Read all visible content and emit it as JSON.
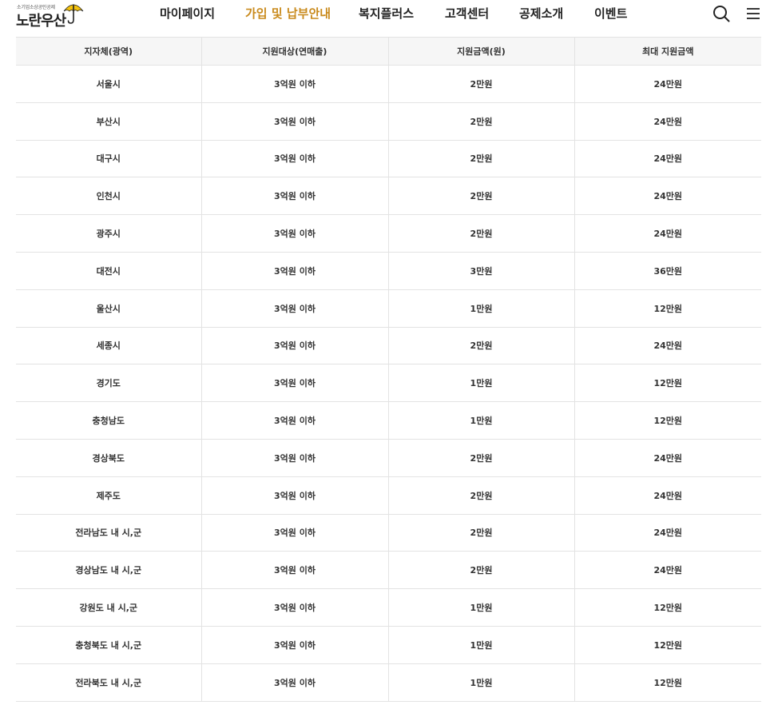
{
  "header": {
    "logo_sub": "소기업소상공인공제",
    "logo_main": "노란우산",
    "nav": [
      {
        "label": "마이페이지",
        "active": false
      },
      {
        "label": "가입 및 납부안내",
        "active": true
      },
      {
        "label": "복지플러스",
        "active": false
      },
      {
        "label": "고객센터",
        "active": false
      },
      {
        "label": "공제소개",
        "active": false
      },
      {
        "label": "이벤트",
        "active": false
      }
    ],
    "icons": [
      "search-icon",
      "menu-icon"
    ]
  },
  "colors": {
    "accent": "#c98a1c",
    "umbrella": "#f4c20d",
    "header_bg": "#f6f6f6",
    "border": "#e3e3e3"
  },
  "table": {
    "headers": [
      "지자체(광역)",
      "지원대상(연매출)",
      "지원금액(원)",
      "최대 지원금액"
    ],
    "rows": [
      [
        "서울시",
        "3억원 이하",
        "2만원",
        "24만원"
      ],
      [
        "부산시",
        "3억원 이하",
        "2만원",
        "24만원"
      ],
      [
        "대구시",
        "3억원 이하",
        "2만원",
        "24만원"
      ],
      [
        "인천시",
        "3억원 이하",
        "2만원",
        "24만원"
      ],
      [
        "광주시",
        "3억원 이하",
        "2만원",
        "24만원"
      ],
      [
        "대전시",
        "3억원 이하",
        "3만원",
        "36만원"
      ],
      [
        "울산시",
        "3억원 이하",
        "1만원",
        "12만원"
      ],
      [
        "세종시",
        "3억원 이하",
        "2만원",
        "24만원"
      ],
      [
        "경기도",
        "3억원 이하",
        "1만원",
        "12만원"
      ],
      [
        "충청남도",
        "3억원 이하",
        "1만원",
        "12만원"
      ],
      [
        "경상북도",
        "3억원 이하",
        "2만원",
        "24만원"
      ],
      [
        "제주도",
        "3억원 이하",
        "2만원",
        "24만원"
      ],
      [
        "전라남도 내 시,군",
        "3억원 이하",
        "2만원",
        "24만원"
      ],
      [
        "경상남도 내 시,군",
        "3억원 이하",
        "2만원",
        "24만원"
      ],
      [
        "강원도 내 시,군",
        "3억원 이하",
        "1만원",
        "12만원"
      ],
      [
        "충청북도 내 시,군",
        "3억원 이하",
        "1만원",
        "12만원"
      ],
      [
        "전라북도 내 시,군",
        "3억원 이하",
        "1만원",
        "12만원"
      ]
    ]
  }
}
